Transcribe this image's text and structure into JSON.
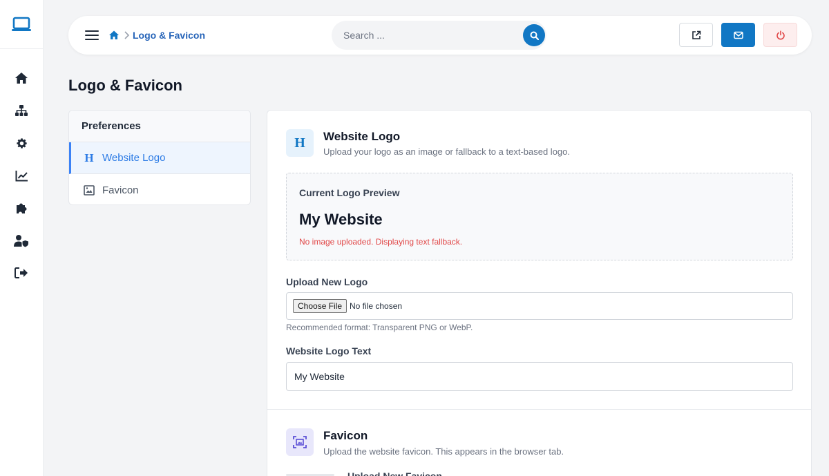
{
  "breadcrumb": {
    "current": "Logo & Favicon"
  },
  "search": {
    "placeholder": "Search ..."
  },
  "page": {
    "title": "Logo & Favicon"
  },
  "preferences": {
    "heading": "Preferences",
    "items": [
      {
        "label": "Website Logo",
        "icon": "heading-icon",
        "active": true
      },
      {
        "label": "Favicon",
        "icon": "image-icon",
        "active": false
      }
    ]
  },
  "logo_section": {
    "title": "Website Logo",
    "subtitle": "Upload your logo as an image or fallback to a text-based logo.",
    "preview_label": "Current Logo Preview",
    "preview_text": "My Website",
    "preview_note": "No image uploaded. Displaying text fallback.",
    "upload_label": "Upload New Logo",
    "file_button": "Choose File",
    "file_status": "No file chosen",
    "upload_help": "Recommended format: Transparent PNG or WebP.",
    "text_label": "Website Logo Text",
    "text_value": "My Website"
  },
  "favicon_section": {
    "title": "Favicon",
    "subtitle": "Upload the website favicon. This appears in the browser tab.",
    "upload_label": "Upload New Favicon"
  },
  "colors": {
    "primary": "#1177c4",
    "accent_blue": "#2c7be5",
    "danger": "#e14848"
  }
}
